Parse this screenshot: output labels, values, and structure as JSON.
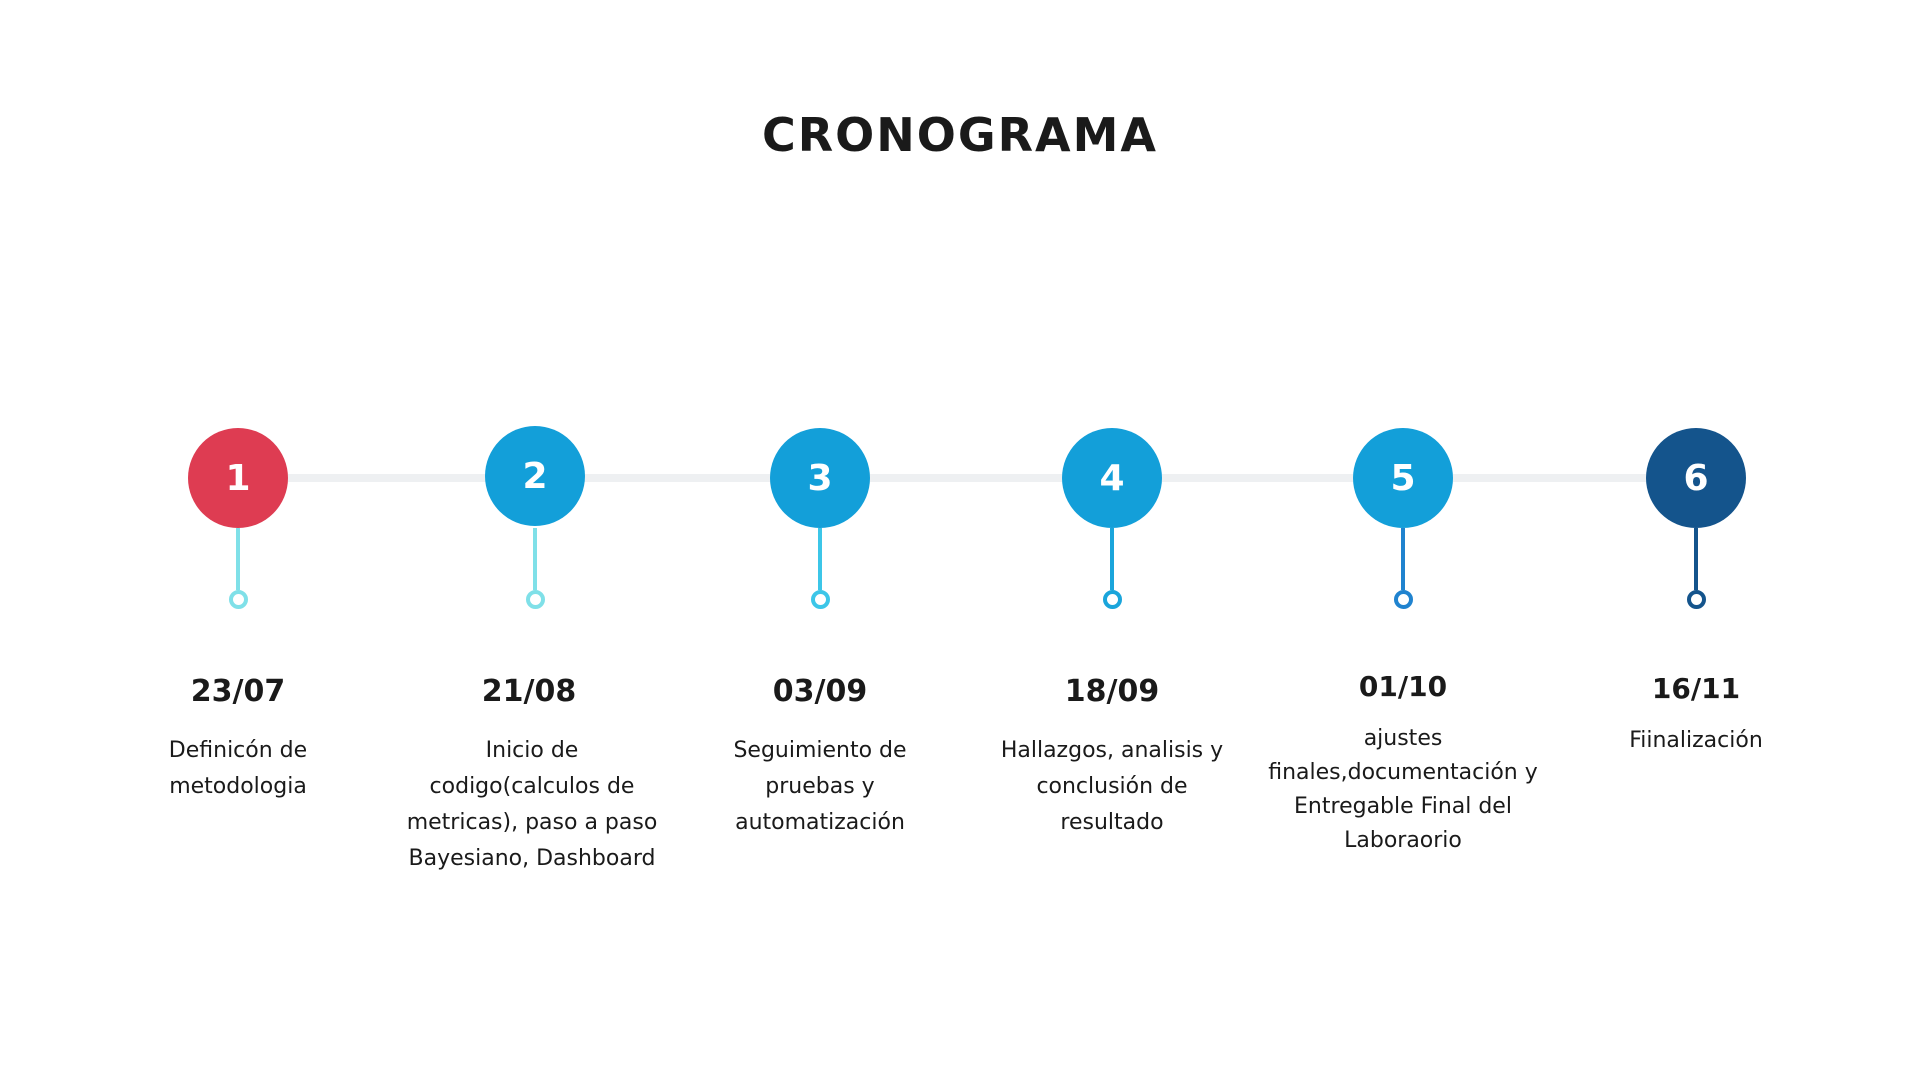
{
  "title": "CRONOGRAMA",
  "colors": {
    "line": "#eef0f2",
    "text": "#1a1a1a"
  },
  "milestones": [
    {
      "number": "1",
      "date": "23/07",
      "description": "Definicón de metodologia",
      "node_color": "#de3c52",
      "stem_color": "#7fe0e8",
      "icon": "circle-number-icon"
    },
    {
      "number": "2",
      "date": "21/08",
      "description": "Inicio de codigo(calculos de metricas), paso a paso Bayesiano, Dashboard",
      "node_color": "#139fd9",
      "stem_color": "#7fe0e8",
      "icon": "circle-number-icon"
    },
    {
      "number": "3",
      "date": "03/09",
      "description": "Seguimiento de pruebas y automatización",
      "node_color": "#139fd9",
      "stem_color": "#3cc6e8",
      "icon": "circle-number-icon"
    },
    {
      "number": "4",
      "date": "18/09",
      "description": "Hallazgos, analisis y conclusión  de resultado",
      "node_color": "#139fd9",
      "stem_color": "#1aa5db",
      "icon": "circle-number-icon"
    },
    {
      "number": "5",
      "date": "01/10",
      "description": "ajustes finales,documentación y Entregable Final del Laboraorio",
      "node_color": "#139fd9",
      "stem_color": "#2083cf",
      "icon": "circle-number-icon"
    },
    {
      "number": "6",
      "date": "16/11",
      "description": "Fiinalización",
      "node_color": "#14548c",
      "stem_color": "#14548c",
      "icon": "circle-number-icon"
    }
  ]
}
